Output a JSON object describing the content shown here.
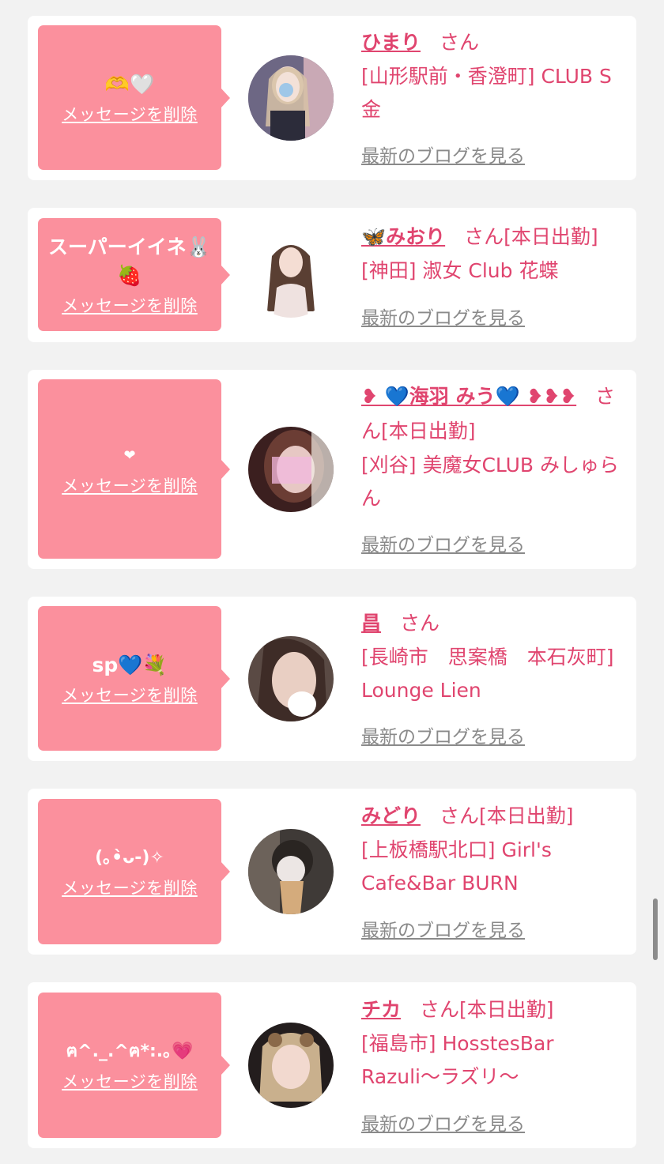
{
  "delete_label": "メッセージを削除",
  "blog_label": "最新のブログを見る",
  "san_label": "さん",
  "colors": {
    "bubble": "#fb909d",
    "accent": "#e0456f",
    "link_gray": "#8a8a8a",
    "background": "#f2f2f2"
  },
  "cards": [
    {
      "message": "🫶🤍",
      "name": "ひまり",
      "status": "",
      "shop": "[山形駅前・香澄町] CLUB S金"
    },
    {
      "message": "スーパーイイネ🐰🍓",
      "name": "🦋みおり",
      "status": "[本日出勤]",
      "shop": "[神田] 淑女 Club 花蝶"
    },
    {
      "message": "❤",
      "name": "❥ 💙海羽 みう💙 ❥❥❥",
      "status": "[本日出勤]",
      "shop": "[刈谷] 美魔女CLUB みしゅらん"
    },
    {
      "message": "sp💙💐",
      "name": "昌",
      "status": "",
      "shop": "[長崎市　思案橋　本石灰町] Lounge Lien"
    },
    {
      "message": "(｡•̀ᴗ-)✧",
      "name": "みどり",
      "status": "[本日出勤]",
      "shop": "[上板橋駅北口] Girl's Cafe&Bar BURN"
    },
    {
      "message": "ฅ^._.^ฅ*:.｡💗",
      "name": "チカ",
      "status": "[本日出勤]",
      "shop": "[福島市] HosstesBar Razuli〜ラズリ〜"
    }
  ]
}
